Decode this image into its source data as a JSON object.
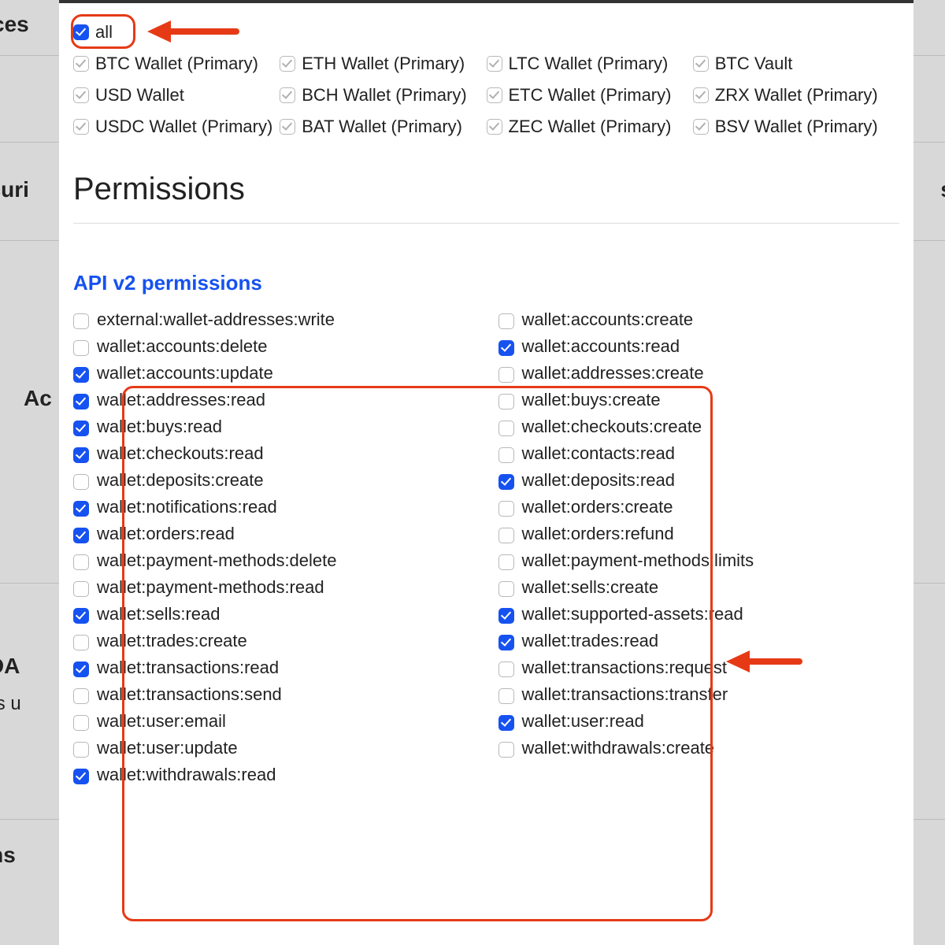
{
  "bg": {
    "t1": "ces",
    "t2": "ecuri",
    "t3": "Ac",
    "t4": "y OA",
    "t5": "ners u",
    "t6": "ons",
    "tr": "s"
  },
  "wallets": {
    "all_label": "all",
    "items": [
      "BTC Wallet (Primary)",
      "ETH Wallet (Primary)",
      "LTC Wallet (Primary)",
      "BTC Vault",
      "USD Wallet",
      "BCH Wallet (Primary)",
      "ETC Wallet (Primary)",
      "ZRX Wallet (Primary)",
      "USDC Wallet (Primary)",
      "BAT Wallet (Primary)",
      "ZEC Wallet (Primary)",
      "BSV Wallet (Primary)"
    ]
  },
  "permissions_heading": "Permissions",
  "api_heading": "API v2 permissions",
  "perms": [
    {
      "label": "external:wallet-addresses:write",
      "checked": false
    },
    {
      "label": "wallet:accounts:create",
      "checked": false
    },
    {
      "label": "wallet:accounts:delete",
      "checked": false
    },
    {
      "label": "wallet:accounts:read",
      "checked": true
    },
    {
      "label": "wallet:accounts:update",
      "checked": true
    },
    {
      "label": "wallet:addresses:create",
      "checked": false
    },
    {
      "label": "wallet:addresses:read",
      "checked": true
    },
    {
      "label": "wallet:buys:create",
      "checked": false
    },
    {
      "label": "wallet:buys:read",
      "checked": true
    },
    {
      "label": "wallet:checkouts:create",
      "checked": false
    },
    {
      "label": "wallet:checkouts:read",
      "checked": true
    },
    {
      "label": "wallet:contacts:read",
      "checked": false
    },
    {
      "label": "wallet:deposits:create",
      "checked": false
    },
    {
      "label": "wallet:deposits:read",
      "checked": true
    },
    {
      "label": "wallet:notifications:read",
      "checked": true
    },
    {
      "label": "wallet:orders:create",
      "checked": false
    },
    {
      "label": "wallet:orders:read",
      "checked": true
    },
    {
      "label": "wallet:orders:refund",
      "checked": false
    },
    {
      "label": "wallet:payment-methods:delete",
      "checked": false
    },
    {
      "label": "wallet:payment-methods:limits",
      "checked": false
    },
    {
      "label": "wallet:payment-methods:read",
      "checked": false
    },
    {
      "label": "wallet:sells:create",
      "checked": false
    },
    {
      "label": "wallet:sells:read",
      "checked": true
    },
    {
      "label": "wallet:supported-assets:read",
      "checked": true
    },
    {
      "label": "wallet:trades:create",
      "checked": false
    },
    {
      "label": "wallet:trades:read",
      "checked": true
    },
    {
      "label": "wallet:transactions:read",
      "checked": true
    },
    {
      "label": "wallet:transactions:request",
      "checked": false
    },
    {
      "label": "wallet:transactions:send",
      "checked": false
    },
    {
      "label": "wallet:transactions:transfer",
      "checked": false
    },
    {
      "label": "wallet:user:email",
      "checked": false
    },
    {
      "label": "wallet:user:read",
      "checked": true
    },
    {
      "label": "wallet:user:update",
      "checked": false
    },
    {
      "label": "wallet:withdrawals:create",
      "checked": false
    },
    {
      "label": "wallet:withdrawals:read",
      "checked": true
    }
  ]
}
